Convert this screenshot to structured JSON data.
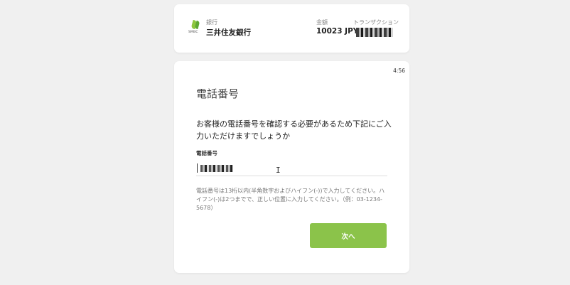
{
  "header": {
    "bank_logo_text": "SMBC",
    "bank_caption": "銀行",
    "bank_name": "三井住友銀行",
    "amount_caption": "金額",
    "amount_value": "10023 JPY",
    "transaction_caption": "トランザクション"
  },
  "form": {
    "timer": "4:56",
    "title": "電話番号",
    "instruction": "お客様の電話番号を確認する必要があるため下記にご入力いただけますでしょうか",
    "phone_label": "電話番号",
    "help_text": "電話番号は13桁以内(半角数字およびハイフン(-))で入力してください。ハイフン(-)は2つまでで、正しい位置に入力してください。（例：03-1234-5678）",
    "next_button": "次へ"
  },
  "colors": {
    "accent": "#8bc34a",
    "background": "#f0f0f0",
    "card": "#ffffff"
  }
}
